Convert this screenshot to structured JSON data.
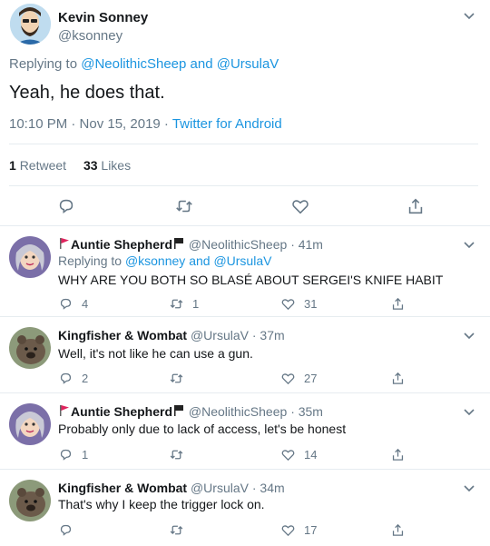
{
  "main_tweet": {
    "display_name": "Kevin Sonney",
    "handle": "@ksonney",
    "replying_prefix": "Replying to",
    "replying_to": [
      "@NeolithicSheep",
      "@UrsulaV"
    ],
    "replying_and": "and",
    "text": "Yeah, he does that.",
    "timestamp": "10:10 PM · Nov 15, 2019 · ",
    "source": "Twitter for Android",
    "retweets_count": "1",
    "retweets_label": "Retweet",
    "likes_count": "33",
    "likes_label": "Likes"
  },
  "replies": [
    {
      "display_name": "Auntie Shepherd",
      "handle": "@NeolithicSheep",
      "time": "· 41m",
      "replying_prefix": "Replying to",
      "replying_to": [
        "@ksonney",
        "@UrsulaV"
      ],
      "replying_and": "and",
      "text": "WHY ARE YOU BOTH SO BLASÉ ABOUT SERGEI'S KNIFE HABIT",
      "reply_count": "4",
      "retweet_count": "1",
      "like_count": "31"
    },
    {
      "display_name": "Kingfisher & Wombat",
      "handle": "@UrsulaV",
      "time": "· 37m",
      "text": "Well, it's not like he can use a gun.",
      "reply_count": "2",
      "retweet_count": "",
      "like_count": "27"
    },
    {
      "display_name": "Auntie Shepherd",
      "handle": "@NeolithicSheep",
      "time": "· 35m",
      "text": "Probably only due to lack of access, let's be honest",
      "reply_count": "1",
      "retweet_count": "",
      "like_count": "14"
    },
    {
      "display_name": "Kingfisher & Wombat",
      "handle": "@UrsulaV",
      "time": "· 34m",
      "text": "That's why I keep the trigger lock on.",
      "reply_count": "",
      "retweet_count": "",
      "like_count": "17"
    }
  ],
  "icons": {
    "caret": "chevron-down-icon",
    "reply": "comment-icon",
    "retweet": "retweet-icon",
    "like": "heart-icon",
    "share": "share-icon",
    "flag_red": "red-flag-icon",
    "flag_black": "black-flag-icon"
  },
  "colors": {
    "link": "#1b95e0",
    "muted": "#657786",
    "text": "#14171a",
    "divider": "#e6ecf0",
    "red_flag": "#e0245e"
  }
}
